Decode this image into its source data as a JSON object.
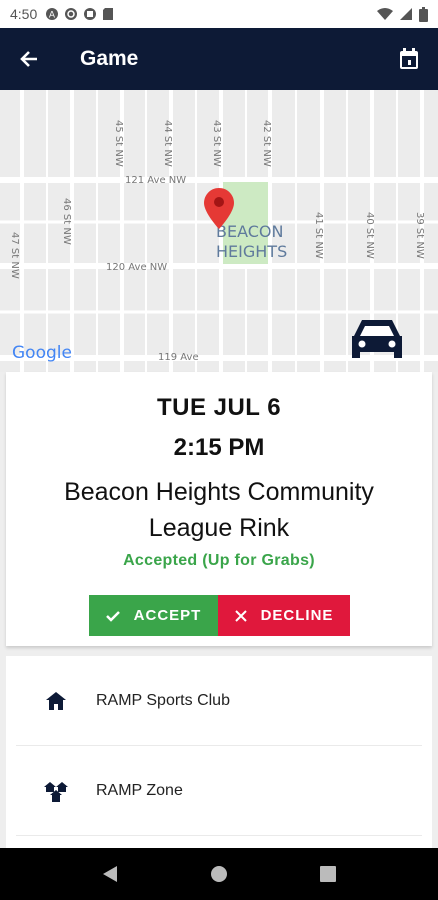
{
  "status_bar": {
    "time": "4:50",
    "left_icons": [
      "notification-icon",
      "sync-icon",
      "app-icon",
      "sd-card-icon"
    ],
    "right_icons": [
      "wifi-icon",
      "signal-icon",
      "battery-icon"
    ]
  },
  "app_bar": {
    "title": "Game",
    "back_icon": "arrow-left-icon",
    "calendar_icon": "calendar-icon"
  },
  "map": {
    "streets": [
      "45 St NW",
      "44 St NW",
      "43 St NW",
      "42 St NW",
      "121 Ave NW",
      "46 St NW",
      "47 St NW",
      "120 Ave NW",
      "41 St NW",
      "40 St NW",
      "39 St NW",
      "119 Ave"
    ],
    "area_label_1": "BEACON",
    "area_label_2": "HEIGHTS",
    "attribution": "Google",
    "marker_color": "#e53935",
    "car_icon": "car-icon"
  },
  "game": {
    "date": "TUE JUL 6",
    "time": "2:15 PM",
    "venue": "Beacon Heights Community League Rink",
    "status": "Accepted (Up for Grabs)",
    "status_color": "#3aa54a",
    "accept_label": "ACCEPT",
    "decline_label": "DECLINE",
    "accept_color": "#3aa54a",
    "decline_color": "#e0183c"
  },
  "details": [
    {
      "icon": "home-icon",
      "label": "RAMP Sports Club"
    },
    {
      "icon": "zone-icon",
      "label": "RAMP Zone"
    }
  ],
  "colors": {
    "app_bar": "#0d1a36"
  }
}
